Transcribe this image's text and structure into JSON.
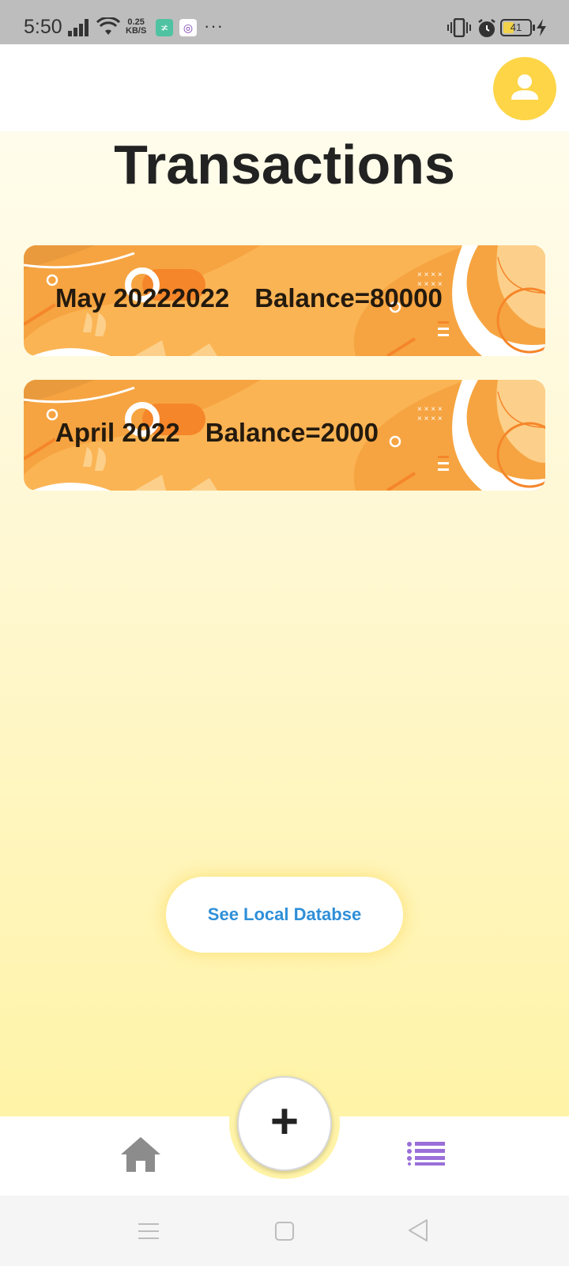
{
  "status_bar": {
    "time": "5:50",
    "net_speed_value": "0.25",
    "net_speed_unit": "KB/S",
    "battery_level": 41,
    "battery_text": "41",
    "icons": [
      "signal-icon",
      "wifi-icon",
      "app-notification-icon",
      "app-notification-icon",
      "more-icon",
      "vibrate-icon",
      "alarm-icon",
      "battery-icon",
      "charging-icon"
    ]
  },
  "header": {
    "title": "Transactions",
    "avatar_icon": "user-icon"
  },
  "transactions": [
    {
      "month": "May 20222022",
      "balance": "Balance=80000"
    },
    {
      "month": "April 2022",
      "balance": "Balance=2000"
    }
  ],
  "actions": {
    "local_db_label": "See Local Databse",
    "fab_label": "+"
  },
  "bottom_nav": {
    "items": [
      "home-icon",
      "list-icon"
    ],
    "active": "list-icon"
  },
  "colors": {
    "accent_yellow": "#fdd547",
    "card_orange": "#fbb454",
    "button_text_blue": "#2f8fd8",
    "active_nav_purple": "#9a6fd8",
    "inactive_nav_gray": "#8c8c8c"
  }
}
